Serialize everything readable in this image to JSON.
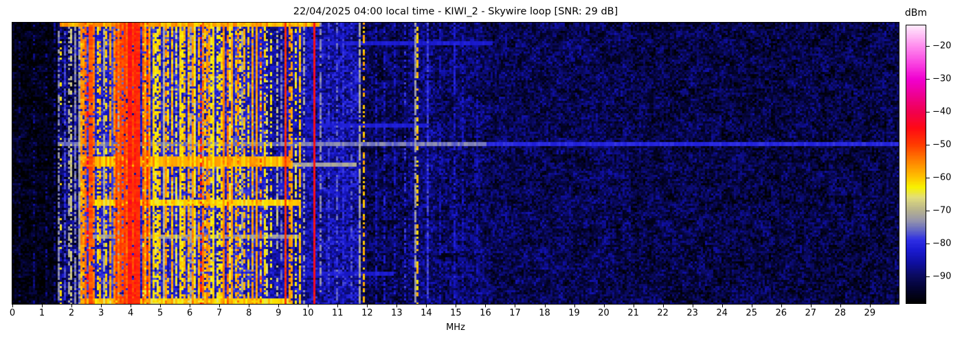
{
  "chart_data": {
    "type": "heatmap",
    "subtype": "radio-spectrogram-waterfall",
    "title": "22/04/2025 04:00 local time - KIWI_2 - Skywire loop [SNR: 29 dB]",
    "xlabel": "MHz",
    "x_range": [
      0,
      29.98
    ],
    "x_ticks": [
      0,
      1,
      2,
      3,
      4,
      5,
      6,
      7,
      8,
      9,
      10,
      11,
      12,
      13,
      14,
      15,
      16,
      17,
      18,
      19,
      20,
      21,
      22,
      23,
      24,
      25,
      26,
      27,
      28,
      29
    ],
    "x_tick_labels": [
      "0",
      "1",
      "2",
      "3",
      "4",
      "5",
      "6",
      "7",
      "8",
      "9",
      "10",
      "11",
      "12",
      "13",
      "14",
      "15",
      "16",
      "17",
      "18",
      "19",
      "20",
      "21",
      "22",
      "23",
      "24",
      "25",
      "26",
      "27",
      "28",
      "29"
    ],
    "grid": false,
    "colorbar": {
      "label": "dBm",
      "position": "right",
      "vmin": -98.2,
      "vmax": -13.7,
      "ticks": [
        -20,
        -30,
        -40,
        -50,
        -60,
        -70,
        -80,
        -90
      ],
      "tick_labels": [
        "−20",
        "−30",
        "−40",
        "−50",
        "−60",
        "−70",
        "−80",
        "−90"
      ]
    },
    "colormap_stops": [
      [
        -98.2,
        "#000000"
      ],
      [
        -93,
        "#04043a"
      ],
      [
        -90,
        "#0a0a5e"
      ],
      [
        -86,
        "#0f0fa0"
      ],
      [
        -82,
        "#1b1bd2"
      ],
      [
        -79,
        "#2e2ee4"
      ],
      [
        -76,
        "#6468c4"
      ],
      [
        -73,
        "#9796ab"
      ],
      [
        -70,
        "#b6b28e"
      ],
      [
        -66,
        "#e2de7a"
      ],
      [
        -63,
        "#f8f200"
      ],
      [
        -60,
        "#ffc400"
      ],
      [
        -55,
        "#ff8200"
      ],
      [
        -50,
        "#ff3c00"
      ],
      [
        -45,
        "#ff0a14"
      ],
      [
        -40,
        "#f1004e"
      ],
      [
        -35,
        "#ee0090"
      ],
      [
        -30,
        "#f000d0"
      ],
      [
        -25,
        "#fa46e2"
      ],
      [
        -20,
        "#ff8cee"
      ],
      [
        -13.7,
        "#ffeafc"
      ]
    ],
    "regions_format": [
      "f_start_mhz",
      "f_end_mhz",
      "base_dbm",
      "noise_amp_db"
    ],
    "regions": [
      [
        0,
        1.5,
        -96,
        3.5
      ],
      [
        1.5,
        2.2,
        -90,
        6
      ],
      [
        2.2,
        8.6,
        -82,
        5
      ],
      [
        8.6,
        9.2,
        -86,
        5
      ],
      [
        9.2,
        10.2,
        -85,
        5
      ],
      [
        10.2,
        11.8,
        -85.5,
        6
      ],
      [
        11.8,
        13.4,
        -91,
        5
      ],
      [
        13.4,
        14.3,
        -88.5,
        5.5
      ],
      [
        14.3,
        16,
        -90,
        5.5
      ],
      [
        16,
        21,
        -91,
        5
      ],
      [
        21,
        29.98,
        -91.8,
        5
      ]
    ],
    "signal_lines_format": [
      "f_mhz",
      "dbm",
      "width_cells",
      "duty_cycle"
    ],
    "signal_lines": [
      [
        0.25,
        -89,
        1,
        0.25
      ],
      [
        0.75,
        -88,
        1,
        0.3
      ],
      [
        1.15,
        -88,
        1,
        0.3
      ],
      [
        1.4,
        -87,
        1,
        0.35
      ],
      [
        1.57,
        -74,
        1,
        0.6
      ],
      [
        1.66,
        -63,
        1,
        0.3
      ],
      [
        1.75,
        -78,
        1,
        0.7
      ],
      [
        1.9,
        -72,
        1,
        0.5
      ],
      [
        2.0,
        -68,
        1,
        0.6
      ],
      [
        2.1,
        -74,
        1,
        0.8
      ],
      [
        2.32,
        -60,
        1,
        0.8
      ],
      [
        2.42,
        -57,
        1,
        0.7
      ],
      [
        2.5,
        -53,
        1,
        0.85
      ],
      [
        2.56,
        -44,
        1,
        0.18
      ],
      [
        2.62,
        -51,
        2,
        0.95
      ],
      [
        2.72,
        -55,
        1,
        0.8
      ],
      [
        2.86,
        -62,
        1,
        0.6
      ],
      [
        2.95,
        -59,
        1,
        0.5
      ],
      [
        3.08,
        -71,
        1,
        0.8
      ],
      [
        3.2,
        -61,
        1,
        0.6
      ],
      [
        3.32,
        -58,
        1,
        0.7
      ],
      [
        3.45,
        -56,
        1,
        0.8
      ],
      [
        3.58,
        -54,
        1,
        0.85
      ],
      [
        3.68,
        -51,
        1,
        0.9
      ],
      [
        3.78,
        -49,
        1,
        0.95
      ],
      [
        3.88,
        -53,
        1,
        0.8
      ],
      [
        3.96,
        -46,
        2,
        1
      ],
      [
        4.07,
        -50,
        1,
        0.9
      ],
      [
        4.18,
        -47,
        1,
        0.95
      ],
      [
        4.28,
        -48,
        2,
        0.95
      ],
      [
        4.4,
        -52,
        1,
        0.85
      ],
      [
        4.5,
        -57,
        1,
        0.8
      ],
      [
        4.62,
        -59,
        1,
        0.75
      ],
      [
        4.75,
        -61,
        1,
        0.7
      ],
      [
        4.88,
        -63,
        1,
        0.65
      ],
      [
        5.0,
        -60,
        1,
        0.7
      ],
      [
        5.12,
        -70,
        1,
        0.8
      ],
      [
        5.25,
        -62,
        1,
        0.6
      ],
      [
        5.38,
        -58,
        1,
        0.7
      ],
      [
        5.55,
        -65,
        1,
        0.6
      ],
      [
        5.68,
        -61,
        1,
        0.65
      ],
      [
        5.85,
        -59,
        1,
        0.7
      ],
      [
        5.95,
        -62,
        1,
        0.6
      ],
      [
        6.08,
        -56,
        1,
        0.8
      ],
      [
        6.2,
        -63,
        1,
        0.6
      ],
      [
        6.3,
        -59,
        1,
        0.7
      ],
      [
        6.37,
        -46,
        1,
        0.3
      ],
      [
        6.44,
        -54,
        1,
        0.7
      ],
      [
        6.55,
        -60,
        1,
        0.6
      ],
      [
        6.68,
        -58,
        1,
        0.65
      ],
      [
        6.8,
        -62,
        1,
        0.6
      ],
      [
        6.95,
        -64,
        1,
        0.55
      ],
      [
        7.05,
        -61,
        1,
        0.6
      ],
      [
        7.18,
        -57,
        1,
        0.7
      ],
      [
        7.3,
        -54,
        1,
        0.8
      ],
      [
        7.42,
        -62,
        1,
        0.6
      ],
      [
        7.56,
        -60,
        1,
        0.6
      ],
      [
        7.7,
        -63,
        1,
        0.55
      ],
      [
        7.85,
        -59,
        1,
        0.6
      ],
      [
        8.0,
        -61,
        1,
        0.6
      ],
      [
        8.1,
        -57,
        1,
        0.7
      ],
      [
        8.26,
        -57,
        1,
        0.97
      ],
      [
        8.42,
        -53,
        1,
        0.4
      ],
      [
        8.6,
        -66,
        1,
        0.5
      ],
      [
        8.75,
        -63,
        1,
        0.45
      ],
      [
        8.95,
        -70,
        1,
        0.5
      ],
      [
        9.1,
        -75,
        1,
        0.6
      ],
      [
        9.26,
        -49,
        1,
        1
      ],
      [
        9.36,
        -56,
        1,
        0.6
      ],
      [
        9.46,
        -58,
        1,
        0.7
      ],
      [
        9.6,
        -64,
        1,
        0.5
      ],
      [
        9.7,
        -60,
        1,
        0.8
      ],
      [
        9.85,
        -72,
        1,
        0.5
      ],
      [
        10.2,
        -45,
        1,
        1
      ],
      [
        10.45,
        -74,
        1,
        0.5
      ],
      [
        10.7,
        -79,
        1,
        0.6
      ],
      [
        10.95,
        -77,
        1,
        0.5
      ],
      [
        11.2,
        -80,
        1,
        0.6
      ],
      [
        11.45,
        -78,
        1,
        0.5
      ],
      [
        11.74,
        -72,
        1,
        0.85
      ],
      [
        11.86,
        -59,
        1,
        0.5
      ],
      [
        12.3,
        -84,
        1,
        0.5
      ],
      [
        12.6,
        -82,
        1,
        0.5
      ],
      [
        12.95,
        -83,
        1,
        0.5
      ],
      [
        13.3,
        -80,
        1,
        0.4
      ],
      [
        13.62,
        -73,
        1,
        0.8
      ],
      [
        13.72,
        -60,
        1,
        0.5
      ],
      [
        14.05,
        -79,
        1,
        0.8
      ],
      [
        14.5,
        -84,
        1,
        0.5
      ],
      [
        14.95,
        -82,
        1,
        0.6
      ],
      [
        15.2,
        -84,
        1,
        0.5
      ],
      [
        15.7,
        -85,
        1,
        0.4
      ]
    ],
    "stripe_band": {
      "f_start": 2.2,
      "f_end": 8.8,
      "count": 60,
      "seed": 1337,
      "hot_zone": [
        3.5,
        4.6
      ]
    },
    "horizontal_streaks_format": [
      "y_frac_start",
      "y_frac_end",
      "f_start_mhz",
      "f_end_mhz",
      "dbm",
      "jitter_db"
    ],
    "horizontal_streaks": [
      [
        0.0,
        0.012,
        1.6,
        10.35,
        -58,
        4
      ],
      [
        0.068,
        0.078,
        9.7,
        16.2,
        -82,
        1.5
      ],
      [
        0.362,
        0.37,
        9.9,
        14.0,
        -82,
        1.5
      ],
      [
        0.425,
        0.433,
        1.5,
        16.0,
        -75,
        2
      ],
      [
        0.425,
        0.433,
        16.0,
        29.97,
        -80,
        1.5
      ],
      [
        0.475,
        0.504,
        2.3,
        9.35,
        -59,
        4
      ],
      [
        0.502,
        0.51,
        2.3,
        11.6,
        -72,
        2
      ],
      [
        0.632,
        0.645,
        2.75,
        9.6,
        -62,
        3
      ],
      [
        0.757,
        0.764,
        2.5,
        9.6,
        -73,
        2
      ],
      [
        0.885,
        0.893,
        9.8,
        12.8,
        -82,
        1.5
      ],
      [
        0.982,
        1.0,
        2.3,
        9.35,
        -62,
        4
      ]
    ],
    "seed": 42
  }
}
